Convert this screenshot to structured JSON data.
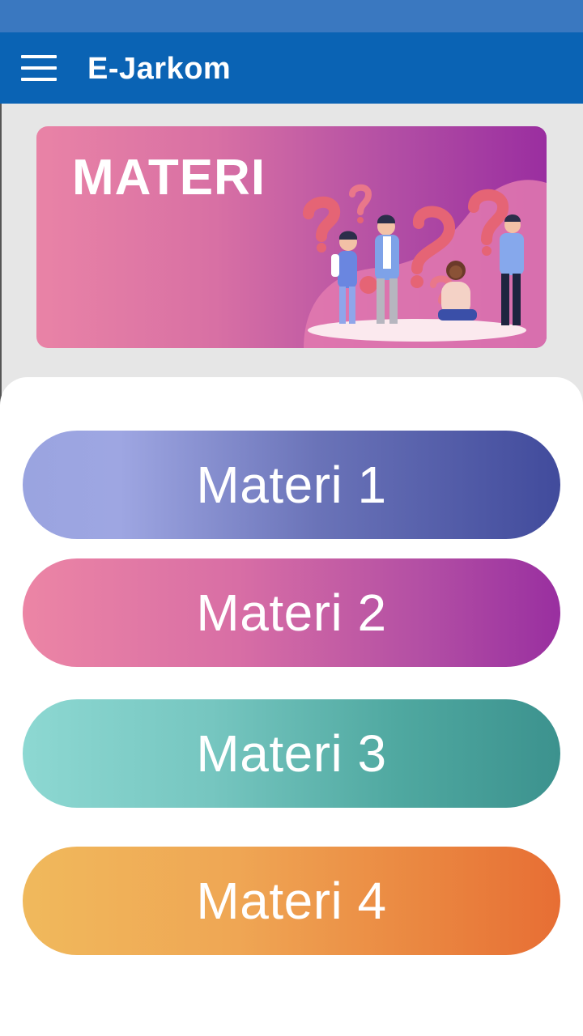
{
  "app_bar": {
    "title": "E-Jarkom",
    "menu_icon": "hamburger-menu-icon",
    "color": "#0a63b4",
    "status_bar_color": "#3a78c0"
  },
  "banner": {
    "title": "MATERI",
    "illustration": "people-with-question-marks-illustration"
  },
  "materials": [
    {
      "label": "Materi 1",
      "colors": [
        "#9ea6e2",
        "#414b9c"
      ]
    },
    {
      "label": "Materi 2",
      "colors": [
        "#ec85a5",
        "#992fa0"
      ]
    },
    {
      "label": "Materi 3",
      "colors": [
        "#8dd8d2",
        "#3c928e"
      ]
    },
    {
      "label": "Materi 4",
      "colors": [
        "#f0b95c",
        "#e76e34"
      ]
    }
  ]
}
